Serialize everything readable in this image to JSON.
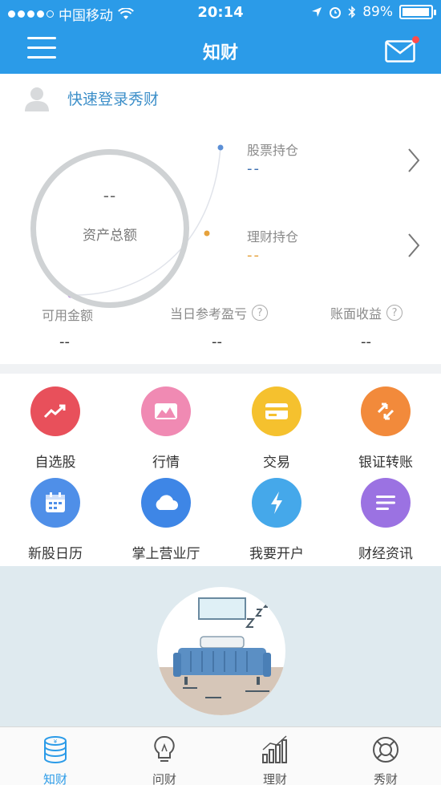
{
  "status_bar": {
    "carrier": "中国移动",
    "time": "20:14",
    "battery": "89%"
  },
  "nav": {
    "title": "知财"
  },
  "account": {
    "login_text": "快速登录秀财"
  },
  "asset": {
    "total_value": "--",
    "total_label": "资产总额"
  },
  "holdings": [
    {
      "label": "股票持仓",
      "value": "--",
      "color": "#3d6fb0"
    },
    {
      "label": "理财持仓",
      "value": "--",
      "color": "#e6a23c"
    }
  ],
  "stats": [
    {
      "label": "可用金额",
      "value": "--"
    },
    {
      "label": "当日参考盈亏",
      "value": "--"
    },
    {
      "label": "账面收益",
      "value": "--"
    }
  ],
  "grid": [
    {
      "label": "自选股",
      "icon": "trend-up-icon",
      "color": "#e8505b"
    },
    {
      "label": "行情",
      "icon": "mountain-chart-icon",
      "color": "#f08ab3"
    },
    {
      "label": "交易",
      "icon": "card-icon",
      "color": "#f5c12e"
    },
    {
      "label": "银证转账",
      "icon": "transfer-arrows-icon",
      "color": "#f28a3b"
    },
    {
      "label": "新股日历",
      "icon": "calendar-icon",
      "color": "#4f8fe8"
    },
    {
      "label": "掌上营业厅",
      "icon": "cloud-icon",
      "color": "#3e86e6"
    },
    {
      "label": "我要开户",
      "icon": "lightning-icon",
      "color": "#45a8ea"
    },
    {
      "label": "财经资讯",
      "icon": "news-lines-icon",
      "color": "#9b72e2"
    }
  ],
  "illustration": {
    "zz": "Z Z Z"
  },
  "tabs": [
    {
      "label": "知财",
      "icon": "coin-stack-icon",
      "active": true
    },
    {
      "label": "问财",
      "icon": "lightbulb-icon",
      "active": false
    },
    {
      "label": "理财",
      "icon": "bar-chart-icon",
      "active": false
    },
    {
      "label": "秀财",
      "icon": "lifebuoy-icon",
      "active": false
    }
  ]
}
